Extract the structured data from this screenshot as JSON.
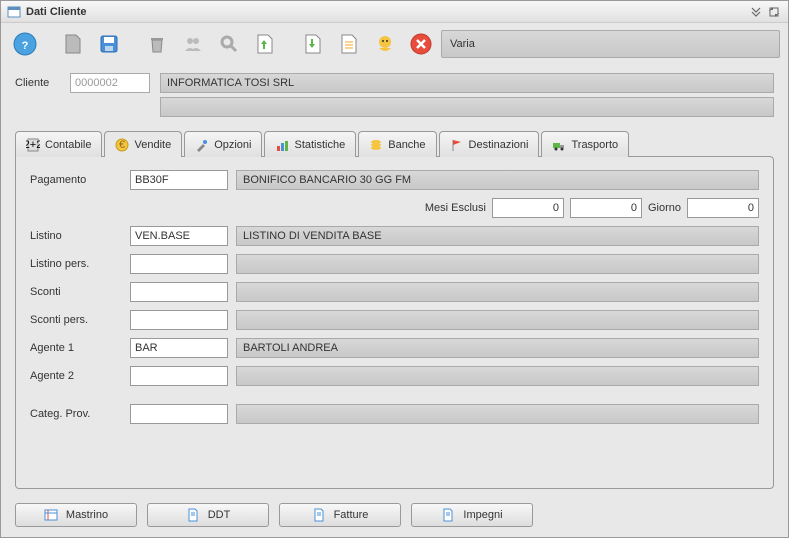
{
  "window": {
    "title": "Dati Cliente"
  },
  "toolbar": {
    "status": "Varia"
  },
  "client": {
    "label": "Cliente",
    "code": "0000002",
    "name": "INFORMATICA TOSI SRL",
    "line2": ""
  },
  "tabs": {
    "contabile": "Contabile",
    "vendite": "Vendite",
    "opzioni": "Opzioni",
    "statistiche": "Statistiche",
    "banche": "Banche",
    "destinazioni": "Destinazioni",
    "trasporto": "Trasporto"
  },
  "vendite": {
    "pagamento": {
      "label": "Pagamento",
      "code": "BB30F",
      "desc": "BONIFICO BANCARIO 30 GG FM"
    },
    "mesi_esclusi": {
      "label": "Mesi Esclusi",
      "v1": "0",
      "v2": "0",
      "giorno_label": "Giorno",
      "giorno": "0"
    },
    "listino": {
      "label": "Listino",
      "code": "VEN.BASE",
      "desc": "LISTINO DI VENDITA BASE"
    },
    "listino_pers": {
      "label": "Listino pers.",
      "code": "",
      "desc": ""
    },
    "sconti": {
      "label": "Sconti",
      "code": "",
      "desc": ""
    },
    "sconti_pers": {
      "label": "Sconti pers.",
      "code": "",
      "desc": ""
    },
    "agente1": {
      "label": "Agente 1",
      "code": "BAR",
      "desc": "BARTOLI ANDREA"
    },
    "agente2": {
      "label": "Agente 2",
      "code": "",
      "desc": ""
    },
    "categ_prov": {
      "label": "Categ. Prov.",
      "code": "",
      "desc": ""
    }
  },
  "buttons": {
    "mastrino": "Mastrino",
    "ddt": "DDT",
    "fatture": "Fatture",
    "impegni": "Impegni"
  }
}
